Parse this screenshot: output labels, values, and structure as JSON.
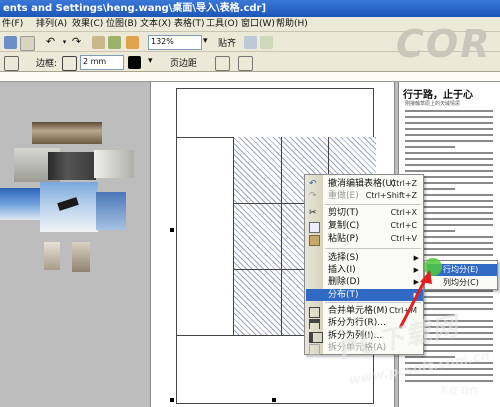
{
  "window": {
    "title": "ents and Settings\\heng.wang\\桌面\\导入\\表格.cdr]"
  },
  "menubar": {
    "items": [
      "件(F)",
      "排列(A)",
      "效果(C)",
      "位图(B)",
      "文本(X)",
      "表格(T)",
      "工具(O)",
      "窗口(W)",
      "帮助(H)"
    ]
  },
  "toolbar": {
    "zoom": "132%",
    "snap_label": "贴齐",
    "outline_label": "边框:",
    "width": "2 mm",
    "pagebreak_label": "页边距"
  },
  "logo": {
    "text": "COR"
  },
  "document": {
    "heading": "行于路，止于心",
    "subheading": "刚接触草原上的天域情思"
  },
  "context_menu": {
    "items": [
      {
        "label": "撤消编辑表格(U)",
        "shortcut": "Ctrl+Z",
        "disabled": false,
        "icon": "undo-icon"
      },
      {
        "label": "重做(E)",
        "shortcut": "Ctrl+Shift+Z",
        "disabled": true,
        "icon": "redo-icon"
      },
      {
        "label": "剪切(T)",
        "shortcut": "Ctrl+X",
        "disabled": false,
        "icon": "cut-icon"
      },
      {
        "label": "复制(C)",
        "shortcut": "Ctrl+C",
        "disabled": false,
        "icon": "copy-icon"
      },
      {
        "label": "粘贴(P)",
        "shortcut": "Ctrl+V",
        "disabled": false,
        "icon": "paste-icon"
      },
      {
        "label": "选择(S)",
        "shortcut": "",
        "disabled": false,
        "submenu": true
      },
      {
        "label": "插入(I)",
        "shortcut": "",
        "disabled": false,
        "submenu": true
      },
      {
        "label": "删除(D)",
        "shortcut": "",
        "disabled": false,
        "submenu": true
      },
      {
        "label": "分布(T)",
        "shortcut": "",
        "disabled": false,
        "submenu": true,
        "highlighted": true
      },
      {
        "label": "合并单元格(M)",
        "shortcut": "Ctrl+M",
        "disabled": false,
        "icon": "merge-cells-icon"
      },
      {
        "label": "拆分为行(R)...",
        "shortcut": "",
        "disabled": false,
        "icon": "split-rows-icon"
      },
      {
        "label": "拆分为列(I)...",
        "shortcut": "",
        "disabled": false,
        "icon": "split-columns-icon"
      },
      {
        "label": "拆分单元格(A)",
        "shortcut": "",
        "disabled": true,
        "icon": "split-cell-icon"
      }
    ]
  },
  "submenu": {
    "items": [
      {
        "label": "行均分(E)",
        "highlighted": true
      },
      {
        "label": "列均分(C)",
        "highlighted": false
      }
    ]
  },
  "watermark": {
    "big": "PC下载网",
    "url": "www.pcsoft.com.cn",
    "small": "系统·软件"
  },
  "colors": {
    "highlight": "#316ac5",
    "menu_bg": "#ece9d8",
    "title_bg": "#1d56b8",
    "hatch": "#9aa6c8",
    "arrow": "#e02020"
  }
}
